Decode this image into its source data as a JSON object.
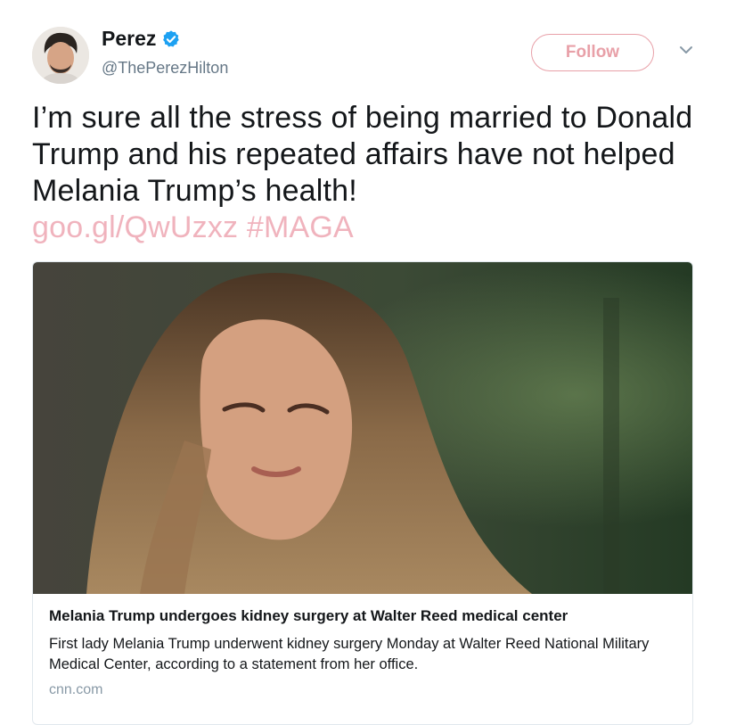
{
  "user": {
    "name": "Perez",
    "handle": "@ThePerezHilton",
    "verified": true,
    "verified_icon": "verified-badge-icon",
    "verified_color": "#1da1f2"
  },
  "actions": {
    "follow_label": "Follow",
    "menu_icon": "chevron-down-icon",
    "accent_color": "#e8a0a8"
  },
  "tweet": {
    "text": "I’m sure all the stress of being married to Donald Trump and his repeated affairs have not helped Melania Trump’s health!",
    "link": "goo.gl/QwUzxz",
    "hashtag": "#MAGA"
  },
  "card": {
    "title": "Melania Trump undergoes kidney surgery at Walter Reed medical center",
    "description": "First lady Melania Trump underwent kidney surgery Monday at Walter Reed National Military Medical Center, according to a statement from her office.",
    "domain": "cnn.com"
  }
}
